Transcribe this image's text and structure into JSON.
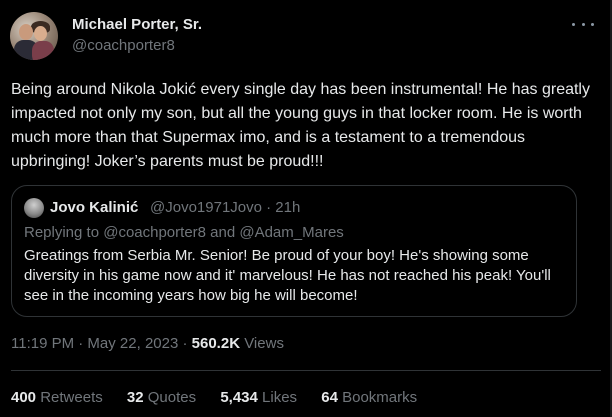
{
  "author": {
    "name": "Michael Porter, Sr.",
    "handle": "@coachporter8"
  },
  "tweet_text": "Being around Nikola Jokić every single day has been instrumental! He has greatly impacted not only my son, but all the young guys in that locker room. He is worth much more than that Supermax imo, and is a testament to a tremendous upbringing! Joker’s parents must be proud!!!",
  "quoted": {
    "name": "Jovo Kalinić",
    "handle": "@Jovo1971Jovo",
    "time": "· 21h",
    "replying_to": "Replying to @coachporter8 and @Adam_Mares",
    "text": "Greatings from Serbia Mr. Senior! Be proud of your boy! He's showing some diversity in his game now and it' marvelous! He has not reached his peak! You'll see in the incoming years how big he will become!"
  },
  "timestamp": {
    "time_date": "11:19 PM · May 22, 2023 · ",
    "views_count": "560.2K",
    "views_label": " Views"
  },
  "stats": {
    "retweets_count": "400",
    "retweets_label": "Retweets",
    "quotes_count": "32",
    "quotes_label": "Quotes",
    "likes_count": "5,434",
    "likes_label": "Likes",
    "bookmarks_count": "64",
    "bookmarks_label": "Bookmarks"
  },
  "icons": {
    "more": "more-options-icon"
  },
  "colors": {
    "background": "#000000",
    "text_primary": "#e7e9ea",
    "text_secondary": "#71767b",
    "border": "#2f3336"
  }
}
